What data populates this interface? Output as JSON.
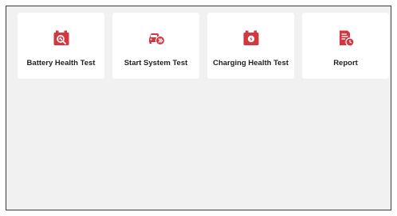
{
  "colors": {
    "accent": "#d1383f",
    "panel_bg": "#f1f1f1",
    "tile_bg": "#ffffff"
  },
  "tiles": [
    {
      "label": "Battery Health Test",
      "icon": "battery-search-icon"
    },
    {
      "label": "Start System Test",
      "icon": "car-forward-icon"
    },
    {
      "label": "Charging Health Test",
      "icon": "battery-charging-icon"
    },
    {
      "label": "Report",
      "icon": "report-clock-icon"
    }
  ]
}
